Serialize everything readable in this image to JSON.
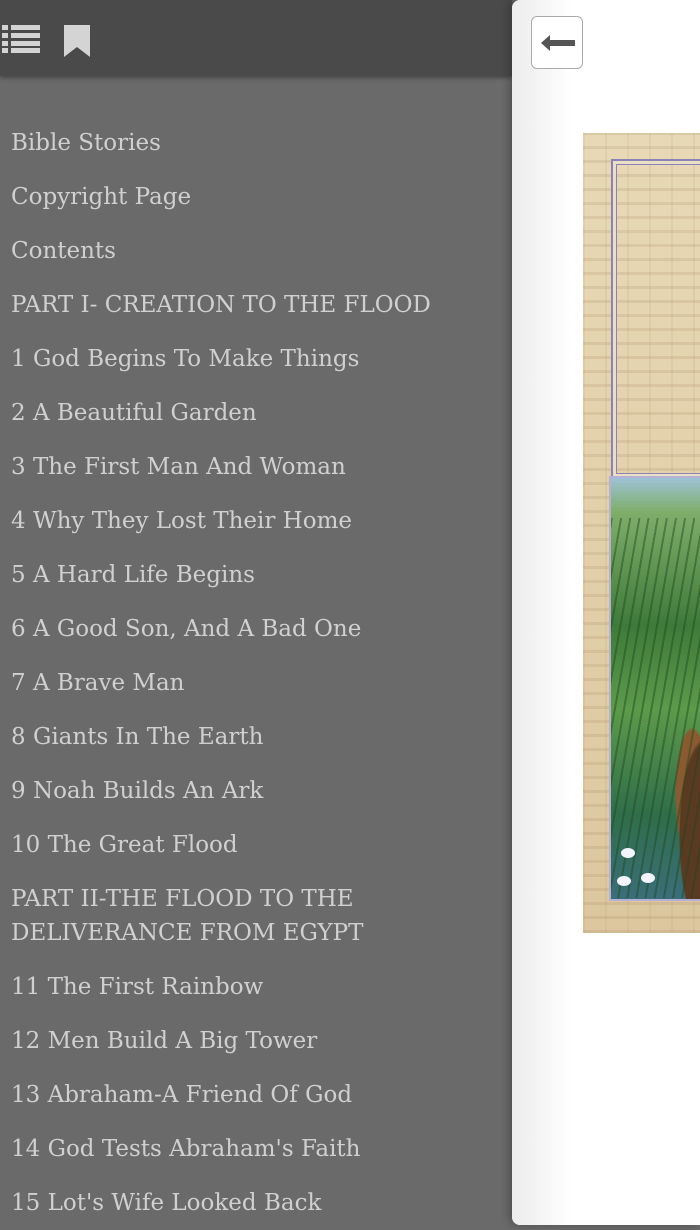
{
  "toolbar": {
    "list_icon": "list-icon",
    "bookmark_icon": "bookmark-icon"
  },
  "toc": {
    "items": [
      "Bible Stories",
      "Copyright Page",
      "Contents",
      "PART I- CREATION TO THE FLOOD",
      "1 God Begins To Make Things",
      "2 A Beautiful Garden",
      "3 The First Man And Woman",
      "4 Why They Lost Their Home",
      "5 A Hard Life Begins",
      "6 A Good Son, And A Bad One",
      "7 A Brave Man",
      "8 Giants In The Earth",
      "9 Noah Builds An Ark",
      "10 The Great Flood",
      "PART II-THE FLOOD TO THE DELIVERANCE FROM EGYPT",
      "11 The First Rainbow",
      "12 Men Build A Big Tower",
      "13 Abraham-A Friend Of God",
      "14 God Tests Abraham's Faith",
      "15 Lot's Wife Looked Back"
    ]
  },
  "reader": {
    "back_icon": "arrow-left-icon"
  },
  "colors": {
    "sidebar_bg": "#6a6a6a",
    "topbar_bg": "#4a4a4a",
    "toc_text": "#d0d0d0",
    "reader_bg": "#ffffff"
  }
}
